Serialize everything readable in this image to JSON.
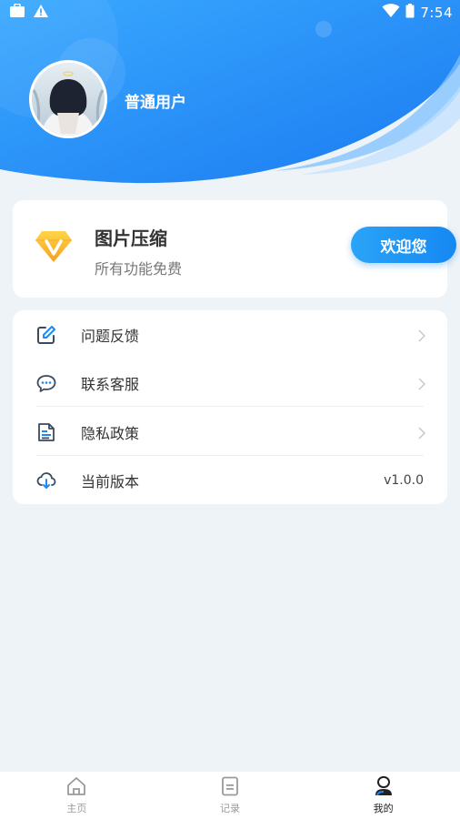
{
  "status_bar": {
    "time": "7:54",
    "icons": [
      "briefcase-icon",
      "warning-icon",
      "wifi-icon",
      "battery-icon"
    ]
  },
  "profile": {
    "username": "普通用户"
  },
  "app_card": {
    "title": "图片压缩",
    "subtitle": "所有功能免费",
    "button_label": "欢迎您",
    "logo": "vip-diamond-icon"
  },
  "menu": {
    "items": [
      {
        "label": "问题反馈",
        "icon": "edit-icon",
        "value": ""
      },
      {
        "label": "联系客服",
        "icon": "chat-icon",
        "value": ""
      },
      {
        "label": "隐私政策",
        "icon": "document-icon",
        "value": ""
      },
      {
        "label": "当前版本",
        "icon": "cloud-download-icon",
        "value": "v1.0.0"
      }
    ]
  },
  "bottom_nav": {
    "items": [
      {
        "label": "主页",
        "icon": "home-icon"
      },
      {
        "label": "记录",
        "icon": "record-icon"
      },
      {
        "label": "我的",
        "icon": "profile-icon"
      }
    ],
    "active": "我的"
  },
  "colors": {
    "primary": "#1688f2",
    "header_gradient_start": "#3aa9ff",
    "header_gradient_end": "#1a7af0",
    "page_background": "#eef3f7"
  }
}
